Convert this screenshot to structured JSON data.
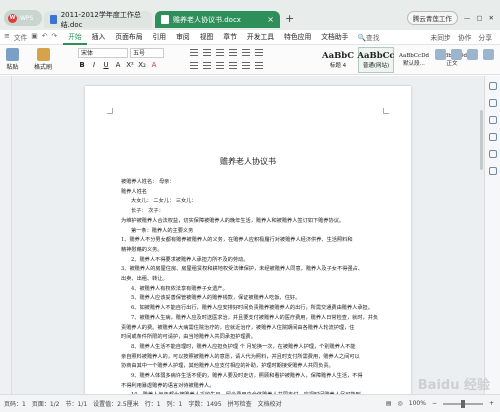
{
  "tabbar": {
    "home_label": "WPS",
    "tabs": [
      {
        "label": "2011-2012学年度工作总结.doc",
        "active": false
      },
      {
        "label": "赡养老人协议书.docx",
        "active": true
      }
    ],
    "user_label": "腾云青莲工作",
    "accent": "#2f8f5b"
  },
  "menu": {
    "file": "文件",
    "items": [
      "开始",
      "插入",
      "页面布局",
      "引用",
      "审阅",
      "视图",
      "章节",
      "开发工具",
      "特色应用",
      "文档助手"
    ],
    "active_index": 0,
    "search": "查找",
    "right": [
      "未同步",
      "协作",
      "分享"
    ]
  },
  "ribbon": {
    "paste": "粘贴",
    "format_painter": "格式刷",
    "font": "宋体",
    "size": "五号",
    "format_buttons": [
      "B",
      "I",
      "U",
      "A",
      "X²",
      "X₂",
      "A"
    ],
    "styles": [
      {
        "sample": "AaBbC",
        "name": "标题 4"
      },
      {
        "sample": "AaBbCc",
        "name": "普通(网站)"
      },
      {
        "sample": "AaBbCcDd",
        "name": "默认段..."
      },
      {
        "sample": "AaBbCcDd",
        "name": "正文"
      }
    ],
    "new_style": "新样式",
    "text_tool": "文字工具",
    "find_replace": "查找替换",
    "select": "选择"
  },
  "document": {
    "title": "赡养老人协议书",
    "lines": [
      {
        "text": "被赡养人姓名：        母亲：",
        "indent": false
      },
      {
        "text": "赡养人姓名",
        "indent": false
      },
      {
        "text": "大女儿：    二女儿：    三女儿：",
        "indent": true
      },
      {
        "text": "长子：      次子：",
        "indent": true
      },
      {
        "text": "为维护被赡养人合法权益，切实保障被赡养人的晚年生活，赡养人和被赡养人签订如下赡养协议。",
        "indent": false
      },
      {
        "text": "第一条：赡养人的主要义务",
        "indent": true
      },
      {
        "text": "1、赡养人不分男女都有赡养被赡养人的义务，在赡养人应积极履行对被赡养人经济供养、生活照料和",
        "indent": false
      },
      {
        "text": "精神慰藉的义务。",
        "indent": false
      },
      {
        "text": "2、赡养人不得要求被赡养人承担力所不及的劳动。",
        "indent": true
      },
      {
        "text": "3、被赡养人的房屋住房、房屋租赁权和耕地权受法律保护，未经被赡养人同意，赡养人及子女不得强占、",
        "indent": false
      },
      {
        "text": "出卖、出租、转让。",
        "indent": false
      },
      {
        "text": "4、被赡养人有权依法享有赡养子女遗产。",
        "indent": true
      },
      {
        "text": "5、赡养人应该妥善保管被赡养人的赡养钱款，保证被赡养人吃饭、住好。",
        "indent": true
      },
      {
        "text": "6、如被赡养人不能自行出行，赡养人应安排好时间负责赡养被赡养人的出行，所需交通费由赡养人承担。",
        "indent": true
      },
      {
        "text": "7、被赡养人生病，赡养人应及时送医求治，并且要支付被赡养人的医疗费用，赡养人日常检查，就时，并负",
        "indent": true
      },
      {
        "text": "责赡养人的费。被赡养人大病需住院治疗的，应就近治疗，被赡养人住院期间由各赡养人轮流护理，住",
        "indent": false
      },
      {
        "text": "时间或条件所限的可请护，由当地赡养人共同承担护理费。",
        "indent": false
      },
      {
        "text": "8、赡养人生活不能自理时，赡养人应担负护理 个 月轮换一次，在被赡养人护理，个别赡养人不能",
        "indent": true
      },
      {
        "text": "亲自照料被赡养人的，可以按照被赡养人的意愿，请人代为照料，并且时支付所需费用，赡养人之间可以",
        "indent": false
      },
      {
        "text": "协商由其中一个赡养人护理，其他赡养人应支付相应的补助，护理时期接受赡养人共同负责。",
        "indent": false
      },
      {
        "text": "9、赡养人体弱多病许生活不便的，赡养人要及时走访，照顾和看护被赡养人，保障赡养人生活，不得",
        "indent": true
      },
      {
        "text": "不得利用暴虐赡养的语言对待被赡养人。",
        "indent": false
      },
      {
        "text": "10、赡养人每年都为被赡养人采收生日，留会费用由全体赡养人共同支付，应视时间赡养人尽可能到",
        "indent": true
      },
      {
        "text": "选出行。每年的节庆，不得在出赡养，遵照被赡养人家养赡养人的选择。",
        "indent": false
      },
      {
        "text": "第二条  赡养的方式、周期",
        "indent": true
      },
      {
        "text": "1、赡养人方是居住的，赡养人应到自轮门赡养，在赡养人每 个 月轮换一次。",
        "indent": true
      }
    ]
  },
  "status": {
    "page": "页码：1",
    "pages": "页面：1/2",
    "section": "节：1/1",
    "position": "设置值：2.5厘米",
    "row": "行：1",
    "col": "列：1",
    "words": "字数：1495",
    "spell": "拼写检查",
    "doc_check": "文档校对",
    "zoom": "100%"
  },
  "watermark": "Baidu 经验"
}
